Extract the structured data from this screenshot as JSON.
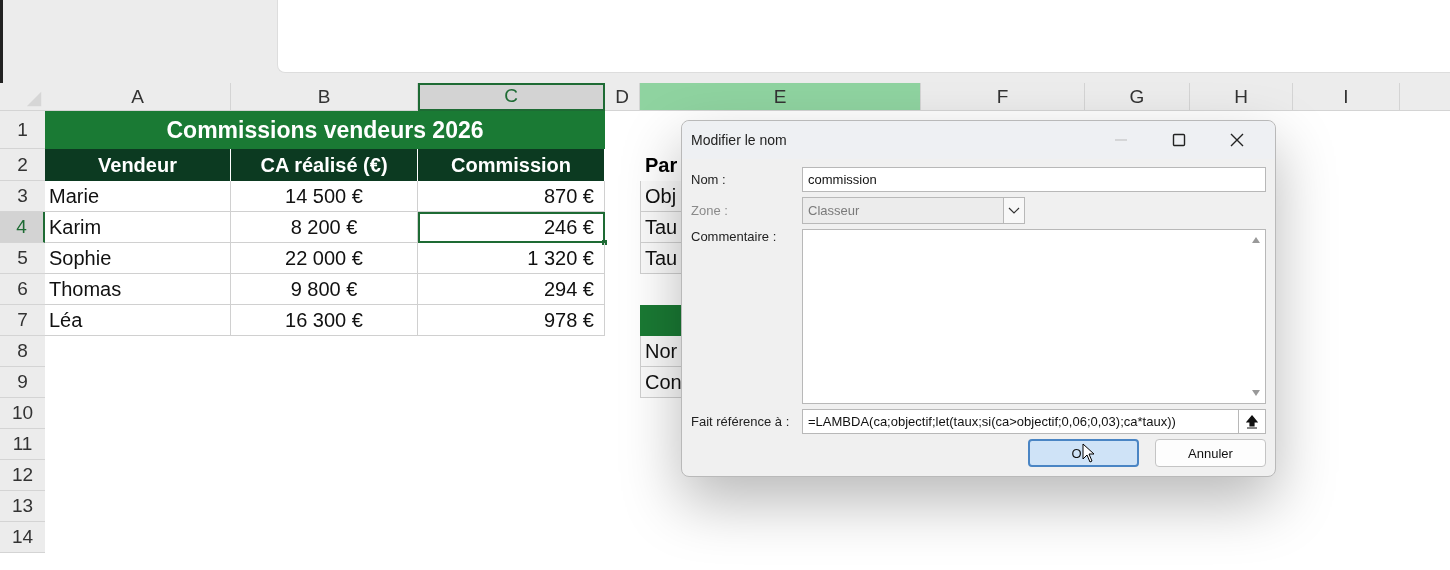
{
  "columns": [
    {
      "label": "A",
      "current": false,
      "selected": false
    },
    {
      "label": "B",
      "current": false,
      "selected": false
    },
    {
      "label": "C",
      "current": true,
      "selected": false
    },
    {
      "label": "D",
      "current": false,
      "selected": false
    },
    {
      "label": "E",
      "current": false,
      "selected": true
    },
    {
      "label": "F",
      "current": false,
      "selected": false
    },
    {
      "label": "G",
      "current": false,
      "selected": false
    },
    {
      "label": "H",
      "current": false,
      "selected": false
    },
    {
      "label": "I",
      "current": false,
      "selected": false
    }
  ],
  "rows": [
    {
      "number": "1",
      "selected": false,
      "cells": [
        {
          "kind": "title",
          "text": "Commissions vendeurs 2026"
        }
      ]
    },
    {
      "number": "2",
      "selected": false,
      "cells": [
        {
          "kind": "header",
          "text": "Vendeur"
        },
        {
          "kind": "header",
          "text": "CA réalisé (€)"
        },
        {
          "kind": "header",
          "text": "Commission"
        },
        null,
        {
          "kind": "section",
          "text": "Par"
        }
      ]
    },
    {
      "number": "3",
      "selected": false,
      "cells": [
        {
          "kind": "name",
          "text": "Marie"
        },
        {
          "kind": "amount",
          "text": "14 500 €"
        },
        {
          "kind": "money",
          "text": "870 €",
          "active": false
        },
        null,
        {
          "kind": "label",
          "text": "Obj"
        }
      ]
    },
    {
      "number": "4",
      "selected": true,
      "cells": [
        {
          "kind": "name",
          "text": "Karim"
        },
        {
          "kind": "amount",
          "text": "8 200 €"
        },
        {
          "kind": "money",
          "text": "246 €",
          "active": true
        },
        null,
        {
          "kind": "label",
          "text": "Tau"
        }
      ]
    },
    {
      "number": "5",
      "selected": false,
      "cells": [
        {
          "kind": "name",
          "text": "Sophie"
        },
        {
          "kind": "amount",
          "text": "22 000 €"
        },
        {
          "kind": "money",
          "text": "1 320 €",
          "active": false
        },
        null,
        {
          "kind": "label",
          "text": "Tau"
        }
      ]
    },
    {
      "number": "6",
      "selected": false,
      "cells": [
        {
          "kind": "name",
          "text": "Thomas"
        },
        {
          "kind": "amount",
          "text": "9 800 €"
        },
        {
          "kind": "money",
          "text": "294 €",
          "active": false
        }
      ]
    },
    {
      "number": "7",
      "selected": false,
      "cells": [
        {
          "kind": "name",
          "text": "Léa"
        },
        {
          "kind": "amount",
          "text": "16 300 €"
        },
        {
          "kind": "money",
          "text": "978 €",
          "active": false
        },
        null,
        {
          "kind": "band"
        }
      ]
    },
    {
      "number": "8",
      "selected": false,
      "cells": [
        null,
        null,
        null,
        null,
        {
          "kind": "label",
          "text": "Nor"
        }
      ]
    },
    {
      "number": "9",
      "selected": false,
      "cells": [
        null,
        null,
        null,
        null,
        {
          "kind": "label",
          "text": "Con"
        }
      ]
    },
    {
      "number": "10",
      "selected": false,
      "cells": []
    },
    {
      "number": "11",
      "selected": false,
      "cells": []
    },
    {
      "number": "12",
      "selected": false,
      "cells": []
    },
    {
      "number": "13",
      "selected": false,
      "cells": []
    },
    {
      "number": "14",
      "selected": false,
      "cells": []
    }
  ],
  "dialog": {
    "title": "Modifier le nom",
    "name": {
      "label": "Nom :",
      "value": "commission"
    },
    "scope": {
      "label": "Zone :",
      "value": "Classeur",
      "disabled": true
    },
    "comment": {
      "label": "Commentaire :"
    },
    "refers_to": {
      "label": "Fait référence à :",
      "value": "=LAMBDA(ca;objectif;let(taux;si(ca>objectif;0,06;0,03);ca*taux))"
    },
    "buttons": [
      {
        "label": "O",
        "focused": true
      },
      {
        "label": "Annuler",
        "focused": false
      }
    ]
  }
}
